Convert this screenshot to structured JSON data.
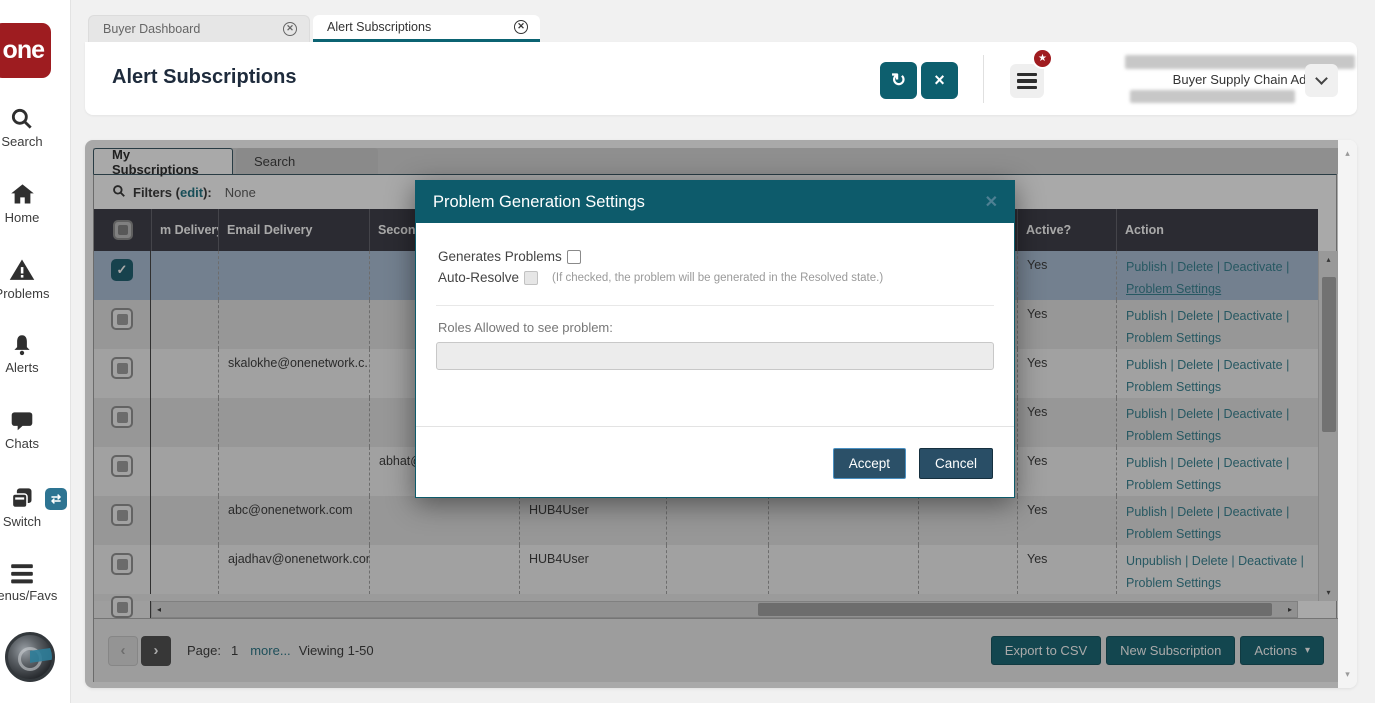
{
  "colors": {
    "accent_teal": "#0d5f6e",
    "modal_header_teal": "#0d5b6b",
    "logo_red": "#9e1c20",
    "badge_red": "#a01c20",
    "selected_row": "#a8bdd6",
    "link_teal": "#2e7d8d",
    "grid_header_bg": "#35353f"
  },
  "sidebar": {
    "logo_text": "one",
    "items": [
      {
        "label": "Search",
        "icon": "search-icon"
      },
      {
        "label": "Home",
        "icon": "home-icon"
      },
      {
        "label": "Problems",
        "icon": "warning-triangle-icon"
      },
      {
        "label": "Alerts",
        "icon": "bell-icon"
      },
      {
        "label": "Chats",
        "icon": "chat-bubble-icon"
      },
      {
        "label": "Switch",
        "icon": "switch-icon",
        "badge_icon": "swap-arrows-icon"
      },
      {
        "label": "Menus/Favs",
        "icon": "hamburger-icon"
      }
    ]
  },
  "tabs": [
    {
      "label": "Buyer Dashboard",
      "active": false
    },
    {
      "label": "Alert Subscriptions",
      "active": true
    }
  ],
  "header": {
    "title": "Alert Subscriptions",
    "refresh_icon": "refresh-icon",
    "close_icon": "close-icon",
    "menu_icon": "hamburger-icon",
    "badge_icon": "star-icon",
    "user_role": "Buyer Supply Chain Admin"
  },
  "inner_tabs": [
    {
      "label": "My Subscriptions",
      "active": true
    },
    {
      "label": "Search",
      "active": false
    }
  ],
  "filters": {
    "prefix": "Filters (",
    "edit_link": "edit",
    "suffix": "):",
    "value": "None"
  },
  "grid": {
    "columns": [
      {
        "label": "",
        "type": "checkbox"
      },
      {
        "label": "m Delivery"
      },
      {
        "label": "Email Delivery"
      },
      {
        "label": "Seconda"
      },
      {
        "label": ""
      },
      {
        "label": ""
      },
      {
        "label": ""
      },
      {
        "label": ""
      },
      {
        "label": "Active?"
      },
      {
        "label": "Action"
      }
    ],
    "rows": [
      {
        "checked": true,
        "selected": true,
        "cells": [
          "",
          "",
          "",
          "",
          "",
          "",
          ""
        ],
        "active": "Yes",
        "actions": [
          "Publish",
          "Delete",
          "Deactivate"
        ],
        "settings_link": "Problem Settings",
        "settings_underlined": true
      },
      {
        "checked": false,
        "selected": false,
        "cells": [
          "",
          "",
          "",
          "",
          "",
          "",
          ""
        ],
        "active": "Yes",
        "actions": [
          "Publish",
          "Delete",
          "Deactivate"
        ],
        "settings_link": "Problem Settings",
        "settings_underlined": false
      },
      {
        "checked": false,
        "selected": false,
        "cells": [
          "",
          "skalokhe@onenetwork.c...",
          "",
          "",
          "",
          "",
          ""
        ],
        "active": "Yes",
        "actions": [
          "Publish",
          "Delete",
          "Deactivate"
        ],
        "settings_link": "Problem Settings",
        "settings_underlined": false
      },
      {
        "checked": false,
        "selected": false,
        "cells": [
          "",
          "",
          "",
          "",
          "",
          "",
          ""
        ],
        "active": "Yes",
        "actions": [
          "Publish",
          "Delete",
          "Deactivate"
        ],
        "settings_link": "Problem Settings",
        "settings_underlined": false
      },
      {
        "checked": false,
        "selected": false,
        "cells": [
          "",
          "",
          "abhat@",
          "",
          "",
          "",
          ""
        ],
        "active": "Yes",
        "actions": [
          "Publish",
          "Delete",
          "Deactivate"
        ],
        "settings_link": "Problem Settings",
        "settings_underlined": false
      },
      {
        "checked": false,
        "selected": false,
        "cells": [
          "",
          "abc@onenetwork.com",
          "",
          "HUB4User",
          "",
          "",
          ""
        ],
        "active": "Yes",
        "actions": [
          "Publish",
          "Delete",
          "Deactivate"
        ],
        "settings_link": "Problem Settings",
        "settings_underlined": false
      },
      {
        "checked": false,
        "selected": false,
        "cells": [
          "",
          "ajadhav@onenetwork.com",
          "",
          "HUB4User",
          "",
          "",
          ""
        ],
        "active": "Yes",
        "actions": [
          "Unpublish",
          "Delete",
          "Deactivate"
        ],
        "settings_link": "Problem Settings",
        "settings_underlined": false
      }
    ]
  },
  "pagination": {
    "page_label": "Page:",
    "page": "1",
    "more_link": "more...",
    "viewing": "Viewing 1-50"
  },
  "footer_buttons": [
    {
      "label": "Export to CSV"
    },
    {
      "label": "New Subscription"
    },
    {
      "label": "Actions",
      "caret": true
    }
  ],
  "modal": {
    "title": "Problem Generation Settings",
    "generates_problems_label": "Generates Problems",
    "generates_problems_checked": false,
    "auto_resolve_label": "Auto-Resolve",
    "auto_resolve_checked": false,
    "auto_resolve_disabled": true,
    "auto_resolve_hint": "(If checked, the problem will be generated in the Resolved state.)",
    "roles_label": "Roles Allowed to see problem:",
    "roles_value": "",
    "accept_label": "Accept",
    "cancel_label": "Cancel"
  }
}
